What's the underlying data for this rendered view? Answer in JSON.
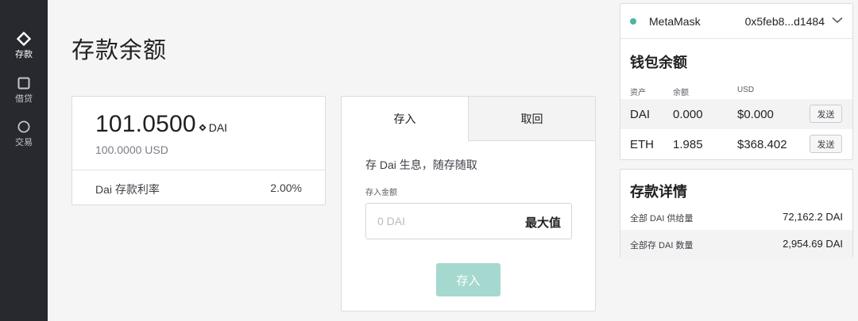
{
  "sidebar": {
    "items": [
      {
        "label": "存款",
        "icon": "diamond-icon",
        "active": true
      },
      {
        "label": "借贷",
        "icon": "square-icon",
        "active": false
      },
      {
        "label": "交易",
        "icon": "circle-icon",
        "active": false
      }
    ]
  },
  "page": {
    "title": "存款余额"
  },
  "balance": {
    "amount": "101.0500",
    "unit": "DAI",
    "usd": "100.0000 USD",
    "rate_label": "Dai 存款利率",
    "rate_value": "2.00%"
  },
  "deposit": {
    "tabs": [
      {
        "label": "存入"
      },
      {
        "label": "取回"
      }
    ],
    "description": "存 Dai 生息，随存随取",
    "amount_label": "存入金额",
    "input_placeholder": "0 DAI",
    "max_label": "最大值",
    "submit_label": "存入"
  },
  "wallet": {
    "provider": "MetaMask",
    "address": "0x5feb8...d1484",
    "title": "钱包余额",
    "columns": [
      "资产",
      "余额",
      "USD"
    ],
    "assets": [
      {
        "asset": "DAI",
        "balance": "0.000",
        "usd": "$0.000",
        "action": "发送"
      },
      {
        "asset": "ETH",
        "balance": "1.985",
        "usd": "$368.402",
        "action": "发送"
      }
    ]
  },
  "details": {
    "title": "存款详情",
    "rows": [
      {
        "label": "全部 DAI 供给量",
        "value": "72,162.2 DAI"
      },
      {
        "label": "全部存 DAI 数量",
        "value": "2,954.69 DAI"
      }
    ]
  },
  "colors": {
    "sidebar_bg": "#27292e",
    "accent": "#a5d9d0",
    "status_dot": "#4db59f"
  }
}
